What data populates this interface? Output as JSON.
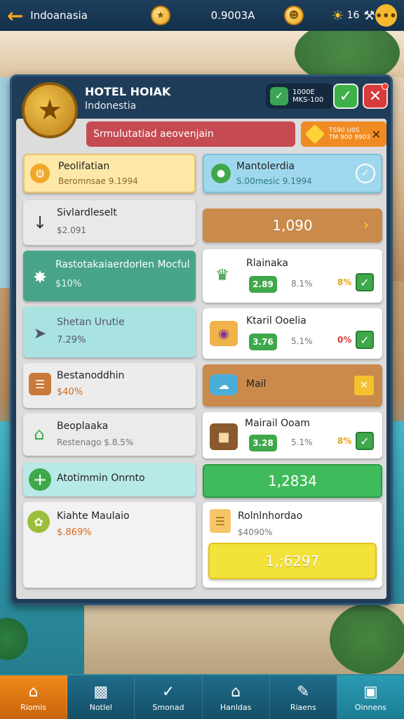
{
  "topbar": {
    "title": "Indoanasia",
    "balance": "0.9003A",
    "level": "16"
  },
  "panel": {
    "hotel_name": "HOTEL HOIAK",
    "country": "Indonestia",
    "status_text_1": "1000E",
    "status_text_2": "MKS-100",
    "alert": "Srmulutatiad aeovenjain",
    "bonus_text_1": "TS90 U0S",
    "bonus_text_2": "TM 900 9903"
  },
  "left_cards": [
    {
      "title": "Peolifatian",
      "sub": "Beromnsae 9.1994"
    },
    {
      "title": "Sivlardleselt",
      "sub": "$2.091"
    },
    {
      "title": "Rastotakaiaerdorlen Mocful",
      "sub": "$10%"
    },
    {
      "title": "Shetan Urutie",
      "sub": "7.29%"
    },
    {
      "title": "Bestanoddhin",
      "sub": "$40%"
    },
    {
      "title": "Beoplaaka",
      "sub": "Restenago $.8.5%"
    },
    {
      "title": "Atotimmin Onrnto",
      "sub": ""
    },
    {
      "title": "Kiahte Maulaio",
      "sub": "$.869%"
    }
  ],
  "right_cards": {
    "header": {
      "title": "Mantolerdia",
      "sub": "S.00mesic 9.1994"
    },
    "value_bar_1": "1,090",
    "items": [
      {
        "title": "Rlainaka",
        "value": "2.89",
        "pct": "8.1%",
        "rate": "8%"
      },
      {
        "title": "Ktaril Ooelia",
        "value": "3.76",
        "pct": "5.1%",
        "rate": "0%"
      },
      {
        "title": "Mairail Ooam",
        "value": "3.28",
        "pct": "5.1%",
        "rate": "8%"
      }
    ],
    "mail": "Mail",
    "value_bar_2": "1,2834",
    "final_title": "Rolnlnhordao",
    "final_sub": "$4090%",
    "value_bar_3": "1,;6297"
  },
  "bottom_nav": [
    "Riomis",
    "Notlel",
    "Smonad",
    "Hanldas",
    "Riaens",
    "Oinnens"
  ],
  "colors": {
    "accent_orange": "#f08a1c",
    "success_green": "#3fa84a",
    "danger_red": "#d83b3b",
    "panel_navy": "#1f3d58"
  }
}
